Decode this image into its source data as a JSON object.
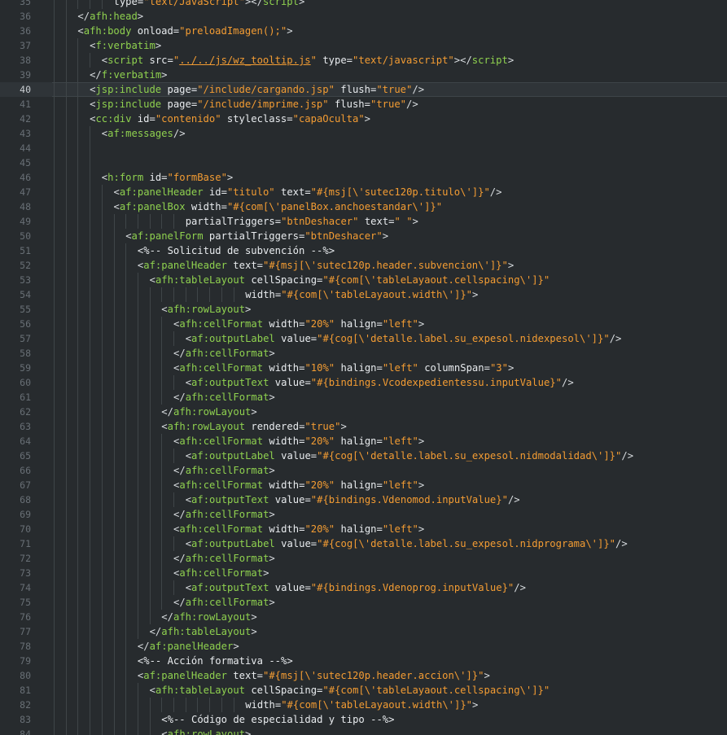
{
  "editor": {
    "current_line": 40,
    "colors": {
      "background": "#272b2e",
      "gutter_text": "#686f75",
      "tag": "#8fd14f",
      "attribute": "#e8ebee",
      "string": "#f39c33",
      "text": "#d8dcdf"
    },
    "lines": [
      {
        "n": 35,
        "indent": 5,
        "tokens": [
          [
            "attr",
            "type="
          ],
          [
            "str",
            "\"text/JavaScript\""
          ],
          [
            "text",
            "></"
          ],
          [
            "tag",
            "script"
          ],
          [
            "text",
            ">"
          ]
        ]
      },
      {
        "n": 36,
        "indent": 2,
        "tokens": [
          [
            "text",
            "</"
          ],
          [
            "tag",
            "afh:head"
          ],
          [
            "text",
            ">"
          ]
        ]
      },
      {
        "n": 36,
        "label": "36",
        "indent": 2,
        "tokens": [
          [
            "text",
            "<"
          ],
          [
            "tag",
            "afh:body"
          ],
          [
            "attr",
            " onload="
          ],
          [
            "str",
            "\"preloadImagen();\""
          ],
          [
            "text",
            ">"
          ]
        ]
      },
      {
        "n": 37,
        "indent": 3,
        "tokens": [
          [
            "text",
            "<"
          ],
          [
            "tag",
            "f:verbatim"
          ],
          [
            "text",
            ">"
          ]
        ]
      },
      {
        "n": 38,
        "indent": 4,
        "tokens": [
          [
            "text",
            "<"
          ],
          [
            "tag",
            "script"
          ],
          [
            "attr",
            " src="
          ],
          [
            "str",
            "\""
          ],
          [
            "str_u",
            "../../js/wz_tooltip.js"
          ],
          [
            "str",
            "\""
          ],
          [
            "attr",
            " type="
          ],
          [
            "str",
            "\"text/javascript\""
          ],
          [
            "text",
            "></"
          ],
          [
            "tag",
            "script"
          ],
          [
            "text",
            ">"
          ]
        ]
      },
      {
        "n": 39,
        "indent": 3,
        "tokens": [
          [
            "text",
            "</"
          ],
          [
            "tag",
            "f:verbatim"
          ],
          [
            "text",
            ">"
          ]
        ]
      },
      {
        "n": 40,
        "indent": 3,
        "tokens": [
          [
            "text",
            "<"
          ],
          [
            "tag",
            "jsp:include"
          ],
          [
            "attr",
            " page="
          ],
          [
            "str",
            "\"/include/cargando.jsp\""
          ],
          [
            "attr",
            " flush="
          ],
          [
            "str",
            "\"true\""
          ],
          [
            "text",
            "/>"
          ]
        ]
      },
      {
        "n": 41,
        "indent": 3,
        "tokens": [
          [
            "text",
            "<"
          ],
          [
            "tag",
            "jsp:include"
          ],
          [
            "attr",
            " page="
          ],
          [
            "str",
            "\"/include/imprime.jsp\""
          ],
          [
            "attr",
            " flush="
          ],
          [
            "str",
            "\"true\""
          ],
          [
            "text",
            "/>"
          ]
        ]
      },
      {
        "n": 42,
        "indent": 3,
        "tokens": [
          [
            "text",
            "<"
          ],
          [
            "tag",
            "cc:div"
          ],
          [
            "attr",
            " id="
          ],
          [
            "str",
            "\"contenido\""
          ],
          [
            "attr",
            " styleclass="
          ],
          [
            "str",
            "\"capaOculta\""
          ],
          [
            "text",
            ">"
          ]
        ]
      },
      {
        "n": 43,
        "indent": 4,
        "tokens": [
          [
            "text",
            "<"
          ],
          [
            "tag",
            "af:messages"
          ],
          [
            "text",
            "/>"
          ]
        ]
      },
      {
        "n": 44,
        "indent": 4,
        "tokens": []
      },
      {
        "n": 45,
        "indent": 4,
        "tokens": []
      },
      {
        "n": 46,
        "indent": 4,
        "tokens": [
          [
            "text",
            "<"
          ],
          [
            "tag",
            "h:form"
          ],
          [
            "attr",
            " id="
          ],
          [
            "str",
            "\"formBase\""
          ],
          [
            "text",
            ">"
          ]
        ]
      },
      {
        "n": 47,
        "indent": 5,
        "tokens": [
          [
            "text",
            "<"
          ],
          [
            "tag",
            "af:panelHeader"
          ],
          [
            "attr",
            " id="
          ],
          [
            "str",
            "\"titulo\""
          ],
          [
            "attr",
            " text="
          ],
          [
            "str",
            "\"#{msj[\\'sutec120p.titulo\\']}\""
          ],
          [
            "text",
            "/>"
          ]
        ]
      },
      {
        "n": 48,
        "indent": 5,
        "tokens": [
          [
            "text",
            "<"
          ],
          [
            "tag",
            "af:panelBox"
          ],
          [
            "attr",
            " width="
          ],
          [
            "str",
            "\"#{com[\\'panelBox.anchoestandar\\']}\""
          ]
        ]
      },
      {
        "n": 49,
        "indent": 5,
        "pad": 6,
        "tokens": [
          [
            "attr",
            "partialTriggers="
          ],
          [
            "str",
            "\"btnDeshacer\""
          ],
          [
            "attr",
            " text="
          ],
          [
            "str",
            "\" \""
          ],
          [
            "text",
            ">"
          ]
        ]
      },
      {
        "n": 50,
        "indent": 6,
        "tokens": [
          [
            "text",
            "<"
          ],
          [
            "tag",
            "af:panelForm"
          ],
          [
            "attr",
            " partialTriggers="
          ],
          [
            "str",
            "\"btnDeshacer\""
          ],
          [
            "text",
            ">"
          ]
        ]
      },
      {
        "n": 51,
        "indent": 7,
        "tokens": [
          [
            "comment",
            "<%-- Solicitud de subvención --%>"
          ]
        ]
      },
      {
        "n": 52,
        "indent": 7,
        "tokens": [
          [
            "text",
            "<"
          ],
          [
            "tag",
            "af:panelHeader"
          ],
          [
            "attr",
            " text="
          ],
          [
            "str",
            "\"#{msj[\\'sutec120p.header.subvencion\\']}\""
          ],
          [
            "text",
            ">"
          ]
        ]
      },
      {
        "n": 53,
        "indent": 8,
        "tokens": [
          [
            "text",
            "<"
          ],
          [
            "tag",
            "afh:tableLayout"
          ],
          [
            "attr",
            " cellSpacing="
          ],
          [
            "str",
            "\"#{com[\\'tableLayaout.cellspacing\\']}\""
          ]
        ]
      },
      {
        "n": 54,
        "indent": 8,
        "pad": 8,
        "tokens": [
          [
            "attr",
            "width="
          ],
          [
            "str",
            "\"#{com[\\'tableLayaout.width\\']}\""
          ],
          [
            "text",
            ">"
          ]
        ]
      },
      {
        "n": 55,
        "indent": 9,
        "tokens": [
          [
            "text",
            "<"
          ],
          [
            "tag",
            "afh:rowLayout"
          ],
          [
            "text",
            ">"
          ]
        ]
      },
      {
        "n": 56,
        "indent": 10,
        "tokens": [
          [
            "text",
            "<"
          ],
          [
            "tag",
            "afh:cellFormat"
          ],
          [
            "attr",
            " width="
          ],
          [
            "str",
            "\"20%\""
          ],
          [
            "attr",
            " halign="
          ],
          [
            "str",
            "\"left\""
          ],
          [
            "text",
            ">"
          ]
        ]
      },
      {
        "n": 57,
        "indent": 11,
        "tokens": [
          [
            "text",
            "<"
          ],
          [
            "tag",
            "af:outputLabel"
          ],
          [
            "attr",
            " value="
          ],
          [
            "str",
            "\"#{cog[\\'detalle.label.su_expesol.nidexpesol\\']}\""
          ],
          [
            "text",
            "/>"
          ]
        ]
      },
      {
        "n": 58,
        "indent": 10,
        "tokens": [
          [
            "text",
            "</"
          ],
          [
            "tag",
            "afh:cellFormat"
          ],
          [
            "text",
            ">"
          ]
        ]
      },
      {
        "n": 59,
        "indent": 10,
        "tokens": [
          [
            "text",
            "<"
          ],
          [
            "tag",
            "afh:cellFormat"
          ],
          [
            "attr",
            " width="
          ],
          [
            "str",
            "\"10%\""
          ],
          [
            "attr",
            " halign="
          ],
          [
            "str",
            "\"left\""
          ],
          [
            "attr",
            " columnSpan="
          ],
          [
            "str",
            "\"3\""
          ],
          [
            "text",
            ">"
          ]
        ]
      },
      {
        "n": 60,
        "indent": 11,
        "tokens": [
          [
            "text",
            "<"
          ],
          [
            "tag",
            "af:outputText"
          ],
          [
            "attr",
            " value="
          ],
          [
            "str",
            "\"#{bindings.Vcodexpedientessu.inputValue}\""
          ],
          [
            "text",
            "/>"
          ]
        ]
      },
      {
        "n": 61,
        "indent": 10,
        "tokens": [
          [
            "text",
            "</"
          ],
          [
            "tag",
            "afh:cellFormat"
          ],
          [
            "text",
            ">"
          ]
        ]
      },
      {
        "n": 62,
        "indent": 9,
        "tokens": [
          [
            "text",
            "</"
          ],
          [
            "tag",
            "afh:rowLayout"
          ],
          [
            "text",
            ">"
          ]
        ]
      },
      {
        "n": 63,
        "indent": 9,
        "tokens": [
          [
            "text",
            "<"
          ],
          [
            "tag",
            "afh:rowLayout"
          ],
          [
            "attr",
            " rendered="
          ],
          [
            "str",
            "\"true\""
          ],
          [
            "text",
            ">"
          ]
        ]
      },
      {
        "n": 64,
        "indent": 10,
        "tokens": [
          [
            "text",
            "<"
          ],
          [
            "tag",
            "afh:cellFormat"
          ],
          [
            "attr",
            " width="
          ],
          [
            "str",
            "\"20%\""
          ],
          [
            "attr",
            " halign="
          ],
          [
            "str",
            "\"left\""
          ],
          [
            "text",
            ">"
          ]
        ]
      },
      {
        "n": 65,
        "indent": 11,
        "tokens": [
          [
            "text",
            "<"
          ],
          [
            "tag",
            "af:outputLabel"
          ],
          [
            "attr",
            " value="
          ],
          [
            "str",
            "\"#{cog[\\'detalle.label.su_expesol.nidmodalidad\\']}\""
          ],
          [
            "text",
            "/>"
          ]
        ]
      },
      {
        "n": 66,
        "indent": 10,
        "tokens": [
          [
            "text",
            "</"
          ],
          [
            "tag",
            "afh:cellFormat"
          ],
          [
            "text",
            ">"
          ]
        ]
      },
      {
        "n": 67,
        "indent": 10,
        "tokens": [
          [
            "text",
            "<"
          ],
          [
            "tag",
            "afh:cellFormat"
          ],
          [
            "attr",
            " width="
          ],
          [
            "str",
            "\"20%\""
          ],
          [
            "attr",
            " halign="
          ],
          [
            "str",
            "\"left\""
          ],
          [
            "text",
            ">"
          ]
        ]
      },
      {
        "n": 68,
        "indent": 11,
        "tokens": [
          [
            "text",
            "<"
          ],
          [
            "tag",
            "af:outputText"
          ],
          [
            "attr",
            " value="
          ],
          [
            "str",
            "\"#{bindings.Vdenomod.inputValue}\""
          ],
          [
            "text",
            "/>"
          ]
        ]
      },
      {
        "n": 69,
        "indent": 10,
        "tokens": [
          [
            "text",
            "</"
          ],
          [
            "tag",
            "afh:cellFormat"
          ],
          [
            "text",
            ">"
          ]
        ]
      },
      {
        "n": 70,
        "indent": 10,
        "tokens": [
          [
            "text",
            "<"
          ],
          [
            "tag",
            "afh:cellFormat"
          ],
          [
            "attr",
            " width="
          ],
          [
            "str",
            "\"20%\""
          ],
          [
            "attr",
            " halign="
          ],
          [
            "str",
            "\"left\""
          ],
          [
            "text",
            ">"
          ]
        ]
      },
      {
        "n": 71,
        "indent": 11,
        "tokens": [
          [
            "text",
            "<"
          ],
          [
            "tag",
            "af:outputLabel"
          ],
          [
            "attr",
            " value="
          ],
          [
            "str",
            "\"#{cog[\\'detalle.label.su_expesol.nidprograma\\']}\""
          ],
          [
            "text",
            "/>"
          ]
        ]
      },
      {
        "n": 72,
        "indent": 10,
        "tokens": [
          [
            "text",
            "</"
          ],
          [
            "tag",
            "afh:cellFormat"
          ],
          [
            "text",
            ">"
          ]
        ]
      },
      {
        "n": 73,
        "indent": 10,
        "tokens": [
          [
            "text",
            "<"
          ],
          [
            "tag",
            "afh:cellFormat"
          ],
          [
            "text",
            ">"
          ]
        ]
      },
      {
        "n": 74,
        "indent": 11,
        "tokens": [
          [
            "text",
            "<"
          ],
          [
            "tag",
            "af:outputText"
          ],
          [
            "attr",
            " value="
          ],
          [
            "str",
            "\"#{bindings.Vdenoprog.inputValue}\""
          ],
          [
            "text",
            "/>"
          ]
        ]
      },
      {
        "n": 75,
        "indent": 10,
        "tokens": [
          [
            "text",
            "</"
          ],
          [
            "tag",
            "afh:cellFormat"
          ],
          [
            "text",
            ">"
          ]
        ]
      },
      {
        "n": 76,
        "indent": 9,
        "tokens": [
          [
            "text",
            "</"
          ],
          [
            "tag",
            "afh:rowLayout"
          ],
          [
            "text",
            ">"
          ]
        ]
      },
      {
        "n": 77,
        "indent": 8,
        "tokens": [
          [
            "text",
            "</"
          ],
          [
            "tag",
            "afh:tableLayout"
          ],
          [
            "text",
            ">"
          ]
        ]
      },
      {
        "n": 78,
        "indent": 7,
        "tokens": [
          [
            "text",
            "</"
          ],
          [
            "tag",
            "af:panelHeader"
          ],
          [
            "text",
            ">"
          ]
        ]
      },
      {
        "n": 79,
        "indent": 7,
        "tokens": [
          [
            "comment",
            "<%-- Acción formativa --%>"
          ]
        ]
      },
      {
        "n": 80,
        "indent": 7,
        "tokens": [
          [
            "text",
            "<"
          ],
          [
            "tag",
            "af:panelHeader"
          ],
          [
            "attr",
            " text="
          ],
          [
            "str",
            "\"#{msj[\\'sutec120p.header.accion\\']}\""
          ],
          [
            "text",
            ">"
          ]
        ]
      },
      {
        "n": 81,
        "indent": 8,
        "tokens": [
          [
            "text",
            "<"
          ],
          [
            "tag",
            "afh:tableLayout"
          ],
          [
            "attr",
            " cellSpacing="
          ],
          [
            "str",
            "\"#{com[\\'tableLayaout.cellspacing\\']}\""
          ]
        ]
      },
      {
        "n": 82,
        "indent": 8,
        "pad": 8,
        "tokens": [
          [
            "attr",
            "width="
          ],
          [
            "str",
            "\"#{com[\\'tableLayaout.width\\']}\""
          ],
          [
            "text",
            ">"
          ]
        ]
      },
      {
        "n": 83,
        "indent": 9,
        "tokens": [
          [
            "comment",
            "<%-- Código de especialidad y tipo --%>"
          ]
        ]
      },
      {
        "n": 84,
        "indent": 9,
        "tokens": [
          [
            "text",
            "<"
          ],
          [
            "tag",
            "afh:rowLayout"
          ],
          [
            "text",
            ">"
          ]
        ]
      }
    ]
  }
}
